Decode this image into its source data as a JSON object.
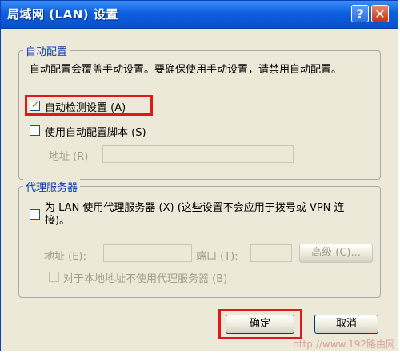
{
  "window": {
    "title": "局域网 (LAN) 设置",
    "help_symbol": "?",
    "close_symbol": "✕"
  },
  "auto_config": {
    "legend": "自动配置",
    "description": "自动配置会覆盖手动设置。要确保使用手动设置，请禁用自动配置。",
    "auto_detect_label": "自动检测设置 (A)",
    "auto_detect_checked": true,
    "script_label": "使用自动配置脚本 (S)",
    "script_checked": false,
    "address_label": "地址 (R)",
    "address_value": ""
  },
  "proxy": {
    "legend": "代理服务器",
    "use_proxy_label": "为 LAN 使用代理服务器 (X) (这些设置不会应用于拨号或 VPN 连接)。",
    "use_proxy_checked": false,
    "address_label": "地址 (E):",
    "address_value": "",
    "port_label": "端口 (T):",
    "port_value": "",
    "advanced_button": "高级 (C)...",
    "bypass_label": "对于本地地址不使用代理服务器 (B)",
    "bypass_checked": false
  },
  "footer": {
    "ok_button": "确定",
    "cancel_button": "取消"
  },
  "watermark": "http://www.192路由网",
  "colors": {
    "titlebar": "#0c5fe0",
    "group_title": "#0b39b3",
    "highlight": "#e01818"
  }
}
